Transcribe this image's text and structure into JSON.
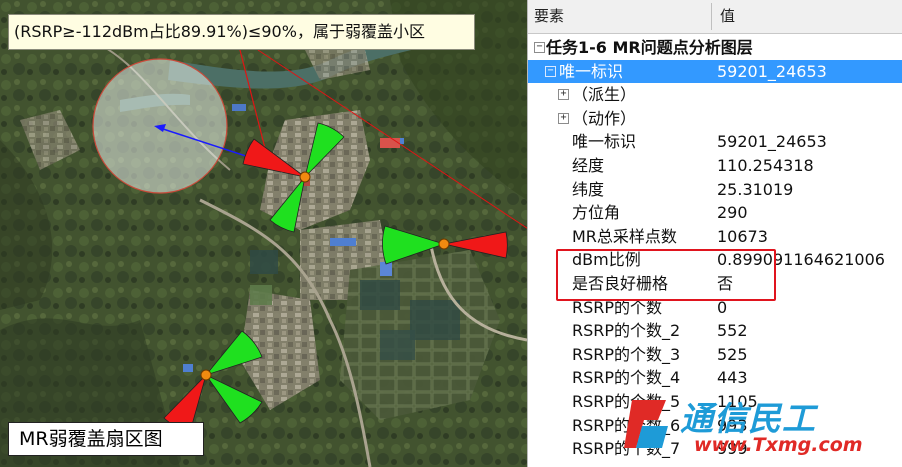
{
  "map": {
    "callout_text": "(RSRP≥-112dBm占比89.91%)≤90%，属于弱覆盖小区",
    "caption": "MR弱覆盖扇区图",
    "colors": {
      "sector_bad": "#f01818",
      "sector_good": "#1fe01f",
      "site": "#f08a10",
      "highlight": "#e01414",
      "arrow": "#1a1aff"
    }
  },
  "grid": {
    "header": {
      "key": "要素",
      "value": "值"
    },
    "rows": [
      {
        "key": "任务1-6 MR问题点分析图层",
        "value": "",
        "level": 0,
        "toggle": "−",
        "group": true
      },
      {
        "key": "唯一标识",
        "value": "59201_24653",
        "level": 1,
        "toggle": "−",
        "selected": true
      },
      {
        "key": "（派生）",
        "value": "",
        "level": 2,
        "toggle": "+"
      },
      {
        "key": "（动作）",
        "value": "",
        "level": 2,
        "toggle": "+"
      },
      {
        "key": "唯一标识",
        "value": "59201_24653",
        "level": 3
      },
      {
        "key": "经度",
        "value": "110.254318",
        "level": 3
      },
      {
        "key": "纬度",
        "value": "25.31019",
        "level": 3
      },
      {
        "key": "方位角",
        "value": "290",
        "level": 3
      },
      {
        "key": "MR总采样点数",
        "value": "10673",
        "level": 3
      },
      {
        "key": "dBm比例",
        "value": "0.899091164621006",
        "level": 3
      },
      {
        "key": "是否良好栅格",
        "value": "否",
        "level": 3
      },
      {
        "key": "RSRP的个数",
        "value": "0",
        "level": 3
      },
      {
        "key": "RSRP的个数_2",
        "value": "552",
        "level": 3
      },
      {
        "key": "RSRP的个数_3",
        "value": "525",
        "level": 3
      },
      {
        "key": "RSRP的个数_4",
        "value": "443",
        "level": 3
      },
      {
        "key": "RSRP的个数_5",
        "value": "1105",
        "level": 3
      },
      {
        "key": "RSRP的个数_6",
        "value": "993",
        "level": 3
      },
      {
        "key": "RSRP的个数_7",
        "value": "999",
        "level": 3
      }
    ]
  },
  "watermark": {
    "brand": "通信民工",
    "url": "www.Txmg.com"
  }
}
